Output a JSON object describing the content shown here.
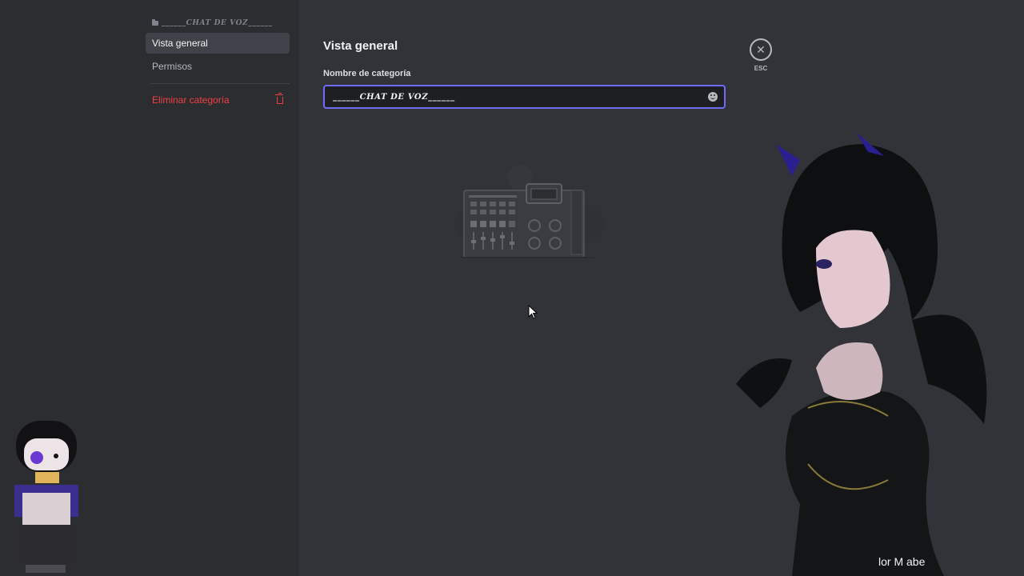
{
  "sidebar": {
    "header": "______CHAT DE VOZ______",
    "items": [
      {
        "label": "Vista general",
        "selected": true
      },
      {
        "label": "Permisos",
        "selected": false
      }
    ],
    "delete_label": "Eliminar categoría"
  },
  "main": {
    "title": "Vista general",
    "field_label": "Nombre de categoría",
    "field_value": "______CHAT DE VOZ______",
    "close_label": "ESC"
  },
  "overlay": {
    "caption": "lor M         abe"
  },
  "colors": {
    "sidebar_bg": "#2b2d31",
    "main_bg": "#313338",
    "input_focus": "#6f6bff",
    "danger": "#f23f43"
  },
  "icons": [
    "folder-icon",
    "trash-icon",
    "emoji-icon",
    "close-icon"
  ]
}
